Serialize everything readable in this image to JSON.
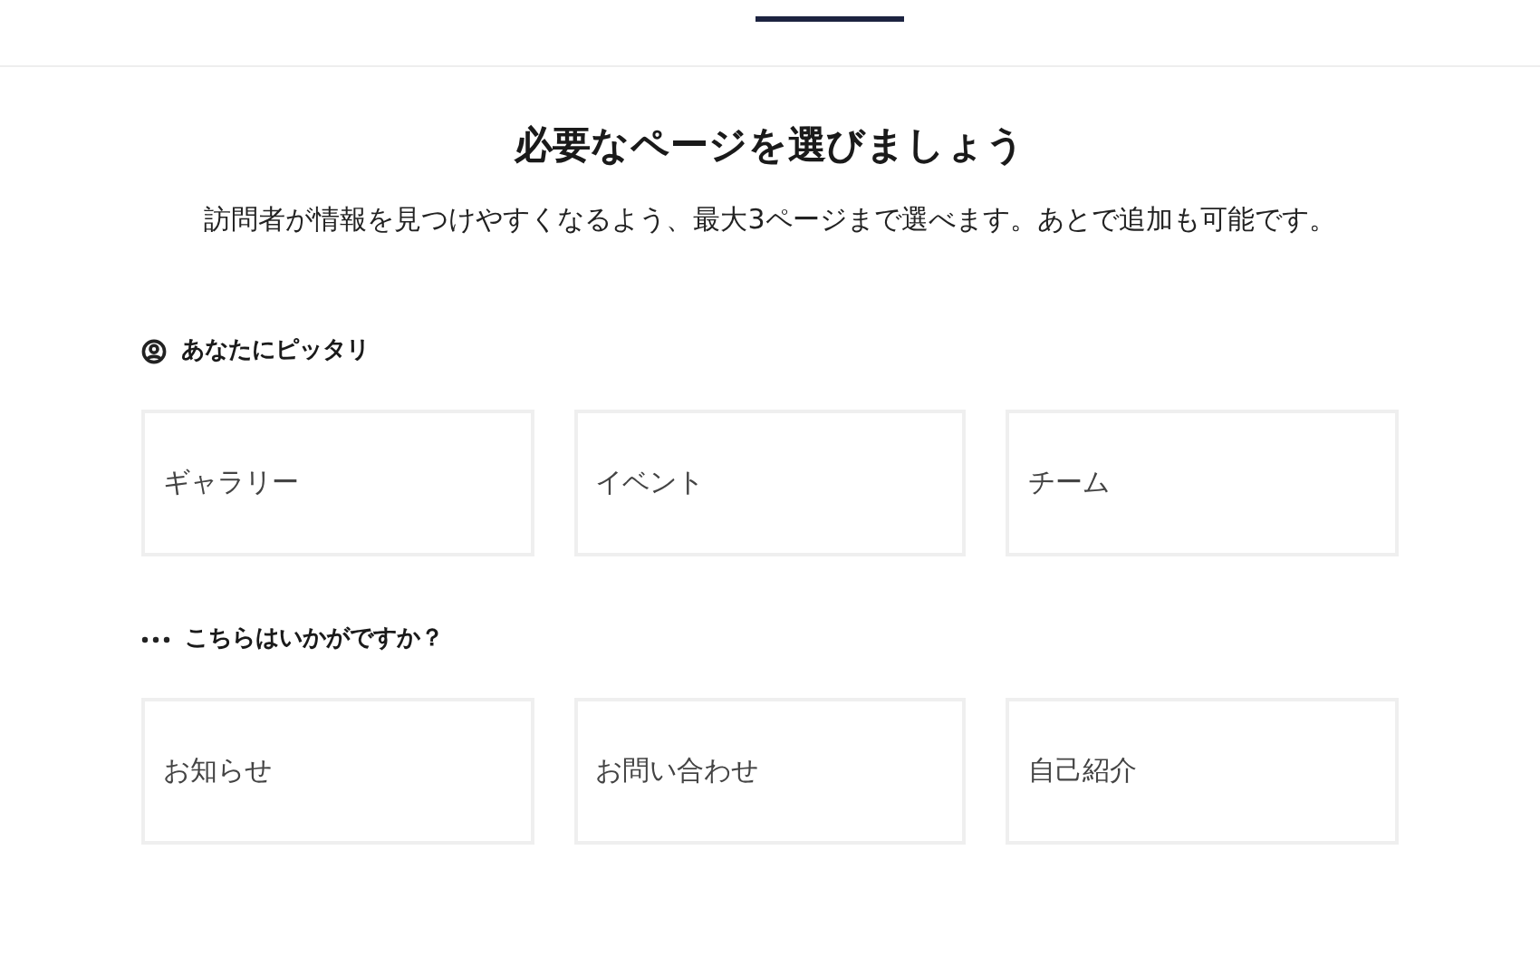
{
  "title": "必要なページを選びましょう",
  "subtitle": "訪問者が情報を見つけやすくなるよう、最大3ページまで選べます。あとで追加も可能です。",
  "sections": [
    {
      "kind": "match",
      "heading": "あなたにピッタリ",
      "pages": [
        "ギャラリー",
        "イベント",
        "チーム"
      ]
    },
    {
      "kind": "more",
      "heading": "こちらはいかがですか？",
      "pages": [
        "お知らせ",
        "お問い合わせ",
        "自己紹介"
      ]
    }
  ]
}
